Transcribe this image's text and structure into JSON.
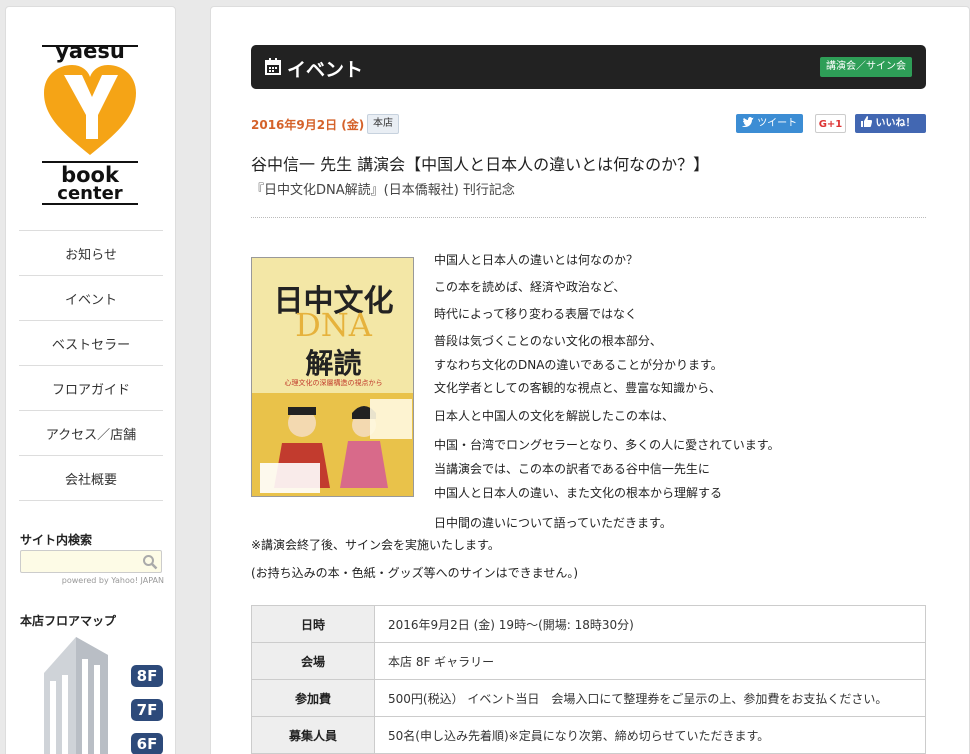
{
  "logo": {
    "line1": "yaesu",
    "line2": "book",
    "line3": "center"
  },
  "nav": [
    "お知らせ",
    "イベント",
    "ベストセラー",
    "フロアガイド",
    "アクセス／店舗",
    "会社概要"
  ],
  "search": {
    "title": "サイト内検索",
    "placeholder": "",
    "powered": "powered by Yahoo! JAPAN"
  },
  "floormap": {
    "title": "本店フロアマップ",
    "floors": [
      "8F",
      "7F",
      "6F"
    ]
  },
  "header": {
    "title": "イベント",
    "category_badge": "講演会／サイン会"
  },
  "event": {
    "date": "2016年9月2日 (金)",
    "store": "本店",
    "title": "谷中信一 先生 講演会【中国人と日本人の違いとは何なのか？】",
    "subtitle": "『日中文化DNA解読』(日本僑報社) 刊行記念",
    "description": [
      "中国人と日本人の違いとは何なのか？",
      "この本を読めば、経済や政治など、",
      "時代によって移り変わる表層ではなく",
      "普段は気づくことのない文化の根本部分、",
      "すなわち文化のDNAの違いであることが分かります。",
      "文化学者としての客観的な視点と、豊富な知識から、",
      "日本人と中国人の文化を解説したこの本は、",
      "中国・台湾でロングセラーとなり、多くの人に愛されています。",
      "当講演会では、この本の訳者である谷中信一先生に",
      "中国人と日本人の違い、また文化の根本から理解する",
      "日中間の違いについて語っていただきます。"
    ],
    "notes": [
      "※講演会終了後、サイン会を実施いたします。",
      "(お持ち込みの本・色紙・グッズ等へのサインはできません。)"
    ]
  },
  "share": {
    "tweet": "ツイート",
    "gplus": "G+1",
    "like": "いいね！"
  },
  "book_cover": {
    "title": "日中文化",
    "dna": "DNA",
    "kaidoku": "解読",
    "tagline": "心理文化の深層構造の視点から"
  },
  "details": [
    {
      "key": "日時",
      "value": "2016年9月2日 (金) 19時～(開場: 18時30分)"
    },
    {
      "key": "会場",
      "value": "本店 8F ギャラリー"
    },
    {
      "key": "参加費",
      "value": "500円(税込） イベント当日　会場入口にて整理券をご呈示の上、参加費をお支払ください。"
    },
    {
      "key": "募集人員",
      "value": "50名(申し込み先着順)※定員になり次第、締め切らせていただきます。"
    }
  ]
}
